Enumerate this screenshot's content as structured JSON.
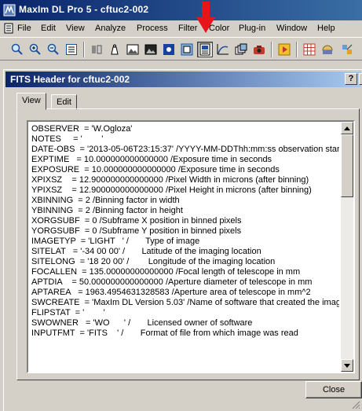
{
  "app": {
    "title": "MaxIm DL Pro 5 - cftuc2-002"
  },
  "menu": [
    {
      "label": "File"
    },
    {
      "label": "Edit"
    },
    {
      "label": "View"
    },
    {
      "label": "Analyze"
    },
    {
      "label": "Process"
    },
    {
      "label": "Filter"
    },
    {
      "label": "Color"
    },
    {
      "label": "Plug-in"
    },
    {
      "label": "Window"
    },
    {
      "label": "Help"
    }
  ],
  "toolbar": {
    "icons": [
      "zoom-icon",
      "zoom-in-icon",
      "zoom-out-icon",
      "info-window-icon",
      "split-icon",
      "weight-icon",
      "image-icon",
      "image-dark-icon",
      "star-icon",
      "frame-icon",
      "screen-stretch-icon",
      "fits-header-icon",
      "curve-icon",
      "layers-icon",
      "camera-icon",
      "play-icon",
      "grid-icon",
      "observatory-icon"
    ],
    "pressed": "fits-header-icon"
  },
  "dialog": {
    "title": "FITS Header for cftuc2-002",
    "help_label": "?",
    "close_label": "X",
    "tabs": [
      {
        "label": "View"
      },
      {
        "label": "Edit"
      }
    ],
    "active_tab": "View",
    "header_lines": [
      "OBSERVER  = 'W.Ogloza'",
      "NOTES     = '        '",
      "DATE-OBS  = '2013-05-06T23:15:37' /YYYY-MM-DDThh:mm:ss observation start",
      "EXPTIME   = 10.000000000000000 /Exposure time in seconds",
      "EXPOSURE  = 10.000000000000000 /Exposure time in seconds",
      "XPIXSZ    = 12.900000000000000 /Pixel Width in microns (after binning)",
      "YPIXSZ    = 12.900000000000000 /Pixel Height in microns (after binning)",
      "XBINNING  = 2 /Binning factor in width",
      "YBINNING  = 2 /Binning factor in height",
      "XORGSUBF  = 0 /Subframe X position in binned pixels",
      "YORGSUBF  = 0 /Subframe Y position in binned pixels",
      "IMAGETYP  = 'LIGHT   ' /       Type of image",
      "SITELAT   = '-34 00 00' /       Latitude of the imaging location",
      "SITELONG  = '18 20 00' /        Longitude of the imaging location",
      "FOCALLEN  = 135.00000000000000 /Focal length of telescope in mm",
      "APTDIA    = 50.000000000000000 /Aperture diameter of telescope in mm",
      "APTAREA   = 1963.4954631328583 /Aperture area of telescope in mm^2",
      "SWCREATE  = 'MaxIm DL Version 5.03' /Name of software that created the image",
      "FLIPSTAT  = '        '",
      "SWOWNER   = 'WO      ' /       Licensed owner of software",
      "INPUTFMT  = 'FITS    ' /       Format of file from which image was read"
    ],
    "close_button": "Close"
  },
  "colors": {
    "title_bar": "#0a246a",
    "window_bg": "#d4d0c8",
    "annotation_arrow": "#e8141c"
  }
}
